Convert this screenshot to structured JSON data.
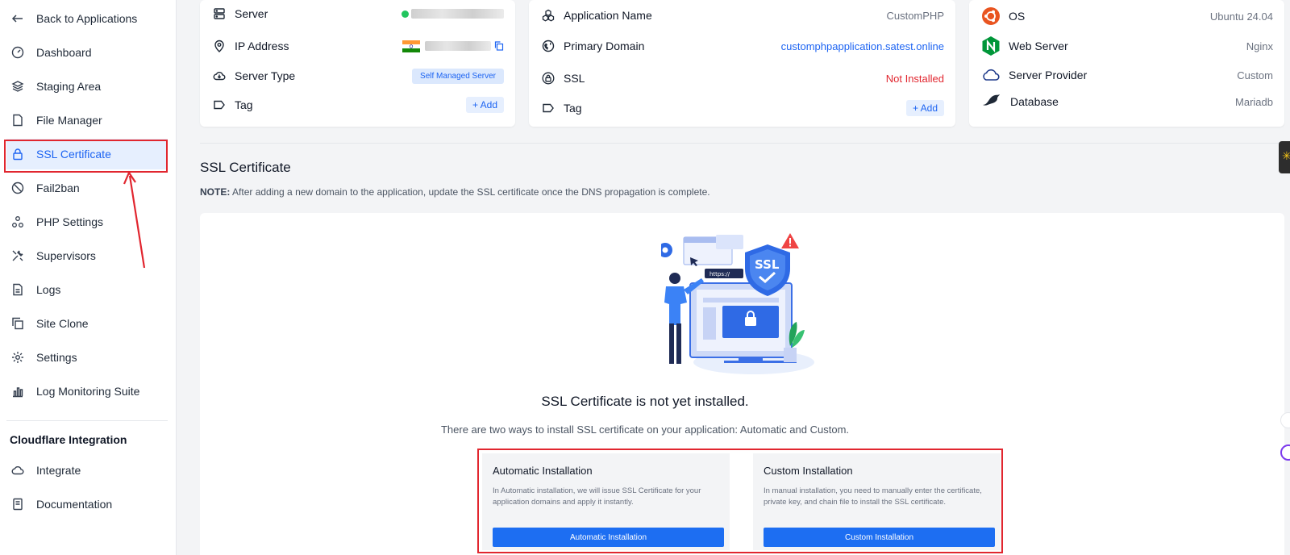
{
  "sidebar": {
    "back": "Back to Applications",
    "items": [
      {
        "label": "Dashboard",
        "icon": "gauge-icon"
      },
      {
        "label": "Staging Area",
        "icon": "layers-icon"
      },
      {
        "label": "File Manager",
        "icon": "file-icon"
      },
      {
        "label": "SSL Certificate",
        "icon": "lock-icon",
        "active": true
      },
      {
        "label": "Fail2ban",
        "icon": "ban-icon"
      },
      {
        "label": "PHP Settings",
        "icon": "nodes-icon"
      },
      {
        "label": "Supervisors",
        "icon": "tools-icon"
      },
      {
        "label": "Logs",
        "icon": "document-icon"
      },
      {
        "label": "Site Clone",
        "icon": "copy-icon"
      },
      {
        "label": "Settings",
        "icon": "gear-icon"
      },
      {
        "label": "Log Monitoring Suite",
        "icon": "bar-chart-icon"
      }
    ],
    "section_title": "Cloudflare Integration",
    "section_items": [
      {
        "label": "Integrate",
        "icon": "cloud-icon"
      },
      {
        "label": "Documentation",
        "icon": "book-icon"
      }
    ]
  },
  "server_card": {
    "server_label": "Server",
    "ip_label": "IP Address",
    "type_label": "Server Type",
    "type_value": "Self Managed Server",
    "tag_label": "Tag",
    "add_label": "+ Add"
  },
  "app_card": {
    "name_label": "Application Name",
    "name_value": "CustomPHP",
    "domain_label": "Primary Domain",
    "domain_value": "customphpapplication.satest.online",
    "ssl_label": "SSL",
    "ssl_value": "Not Installed",
    "tag_label": "Tag",
    "add_label": "+ Add"
  },
  "stack_card": {
    "os_label": "OS",
    "os_value": "Ubuntu 24.04",
    "web_label": "Web Server",
    "web_value": "Nginx",
    "provider_label": "Server Provider",
    "provider_value": "Custom",
    "db_label": "Database",
    "db_value": "Mariadb"
  },
  "ssl_section": {
    "title": "SSL Certificate",
    "note_prefix": "NOTE:",
    "note_text": " After adding a new domain to the application, update the SSL certificate once the DNS propagation is complete.",
    "illus_badge": "SSL",
    "illus_url": "https://",
    "empty_title": "SSL Certificate is not yet installed.",
    "empty_sub": "There are two ways to install SSL certificate on your application: Automatic and Custom.",
    "automatic": {
      "title": "Automatic Installation",
      "desc": "In Automatic installation, we will issue SSL Certificate for your application domains and apply it instantly.",
      "button": "Automatic Installation"
    },
    "custom": {
      "title": "Custom Installation",
      "desc": "In manual installation, you need to manually enter the certificate, private key, and chain file to install the SSL certificate.",
      "button": "Custom Installation"
    }
  },
  "colors": {
    "accent": "#1d64f2",
    "annotation_red": "#e1262f",
    "status_green": "#22c55e"
  }
}
